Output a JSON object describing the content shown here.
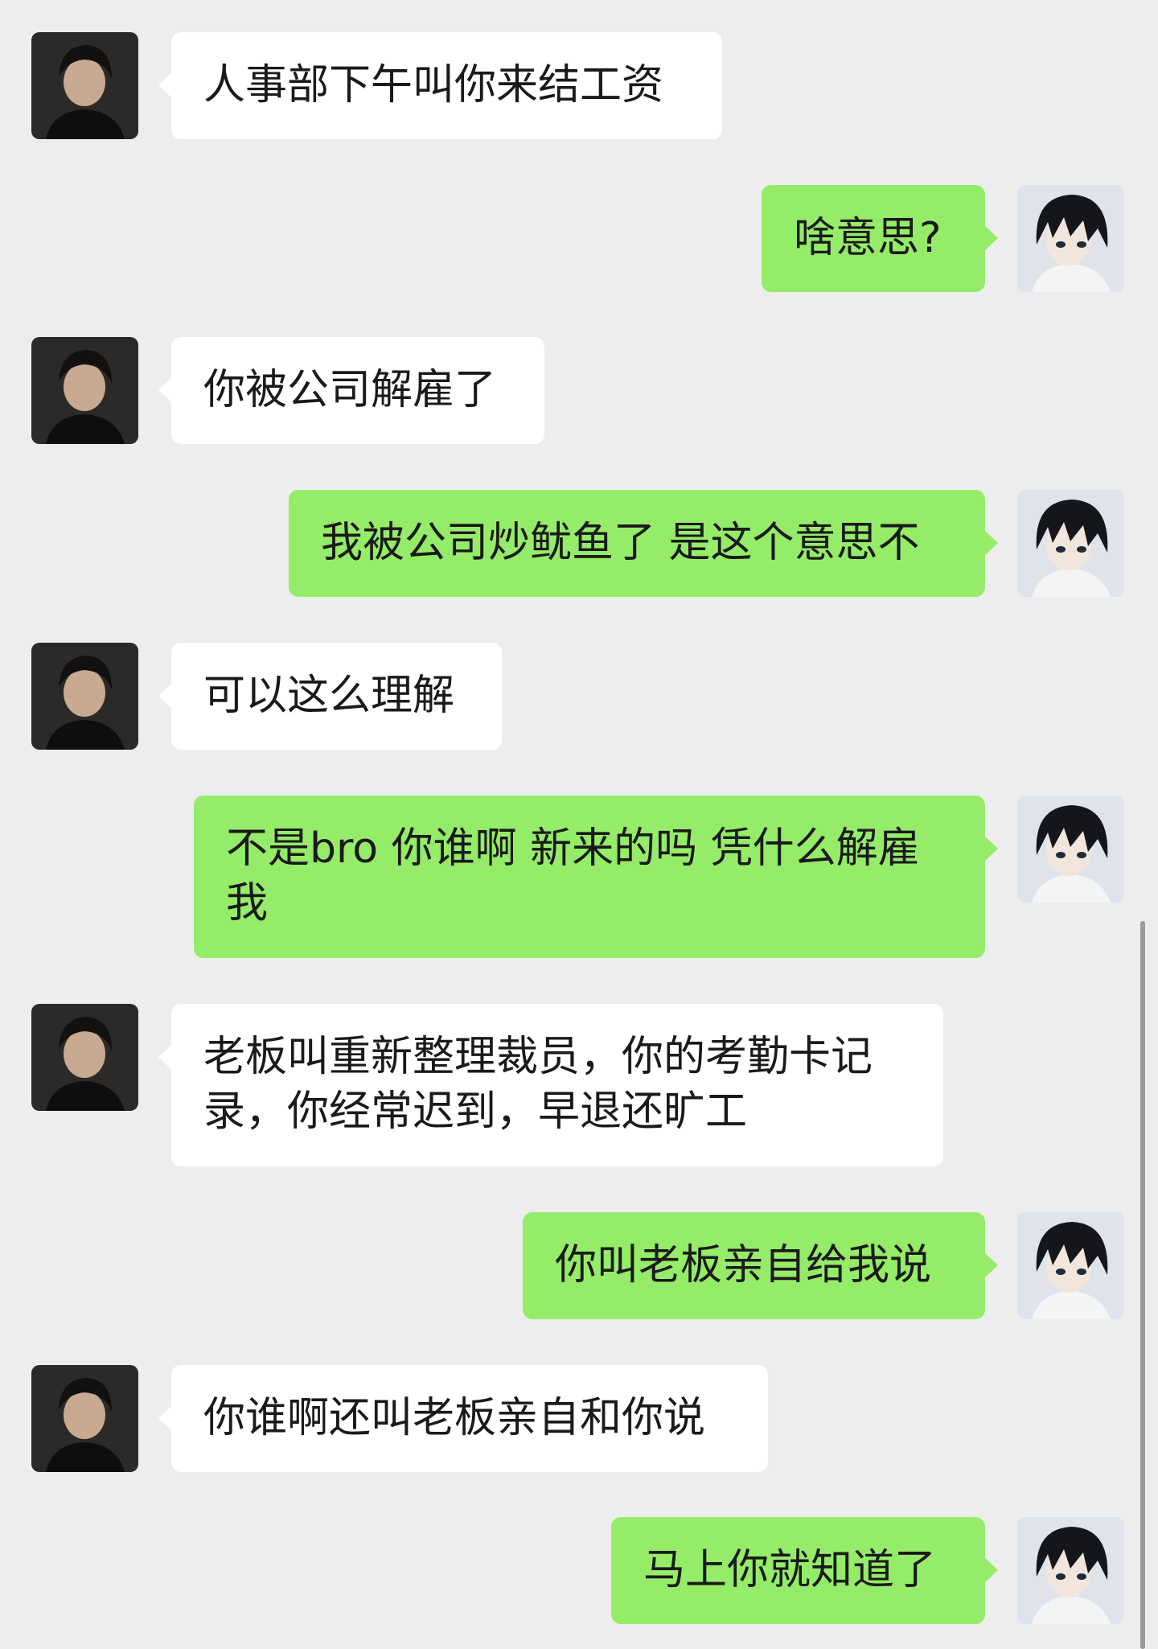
{
  "chat": {
    "messages": [
      {
        "side": "in",
        "text": "人事部下午叫你来结工资"
      },
      {
        "side": "out",
        "text": "啥意思?"
      },
      {
        "side": "in",
        "text": "你被公司解雇了"
      },
      {
        "side": "out",
        "text": "我被公司炒鱿鱼了 是这个意思不"
      },
      {
        "side": "in",
        "text": "可以这么理解"
      },
      {
        "side": "out",
        "text": "不是bro 你谁啊 新来的吗 凭什么解雇我"
      },
      {
        "side": "in",
        "text": "老板叫重新整理裁员，你的考勤卡记录，你经常迟到，早退还旷工"
      },
      {
        "side": "out",
        "text": "你叫老板亲自给我说"
      },
      {
        "side": "in",
        "text": "你谁啊还叫老板亲自和你说"
      },
      {
        "side": "out",
        "text": "马上你就知道了"
      }
    ]
  },
  "colors": {
    "background": "#ededed",
    "incoming_bubble": "#ffffff",
    "outgoing_bubble": "#95ec69",
    "text": "#1a1a1a"
  },
  "icons": {
    "incoming_avatar": "avatar-photo-icon",
    "outgoing_avatar": "avatar-anime-icon"
  }
}
